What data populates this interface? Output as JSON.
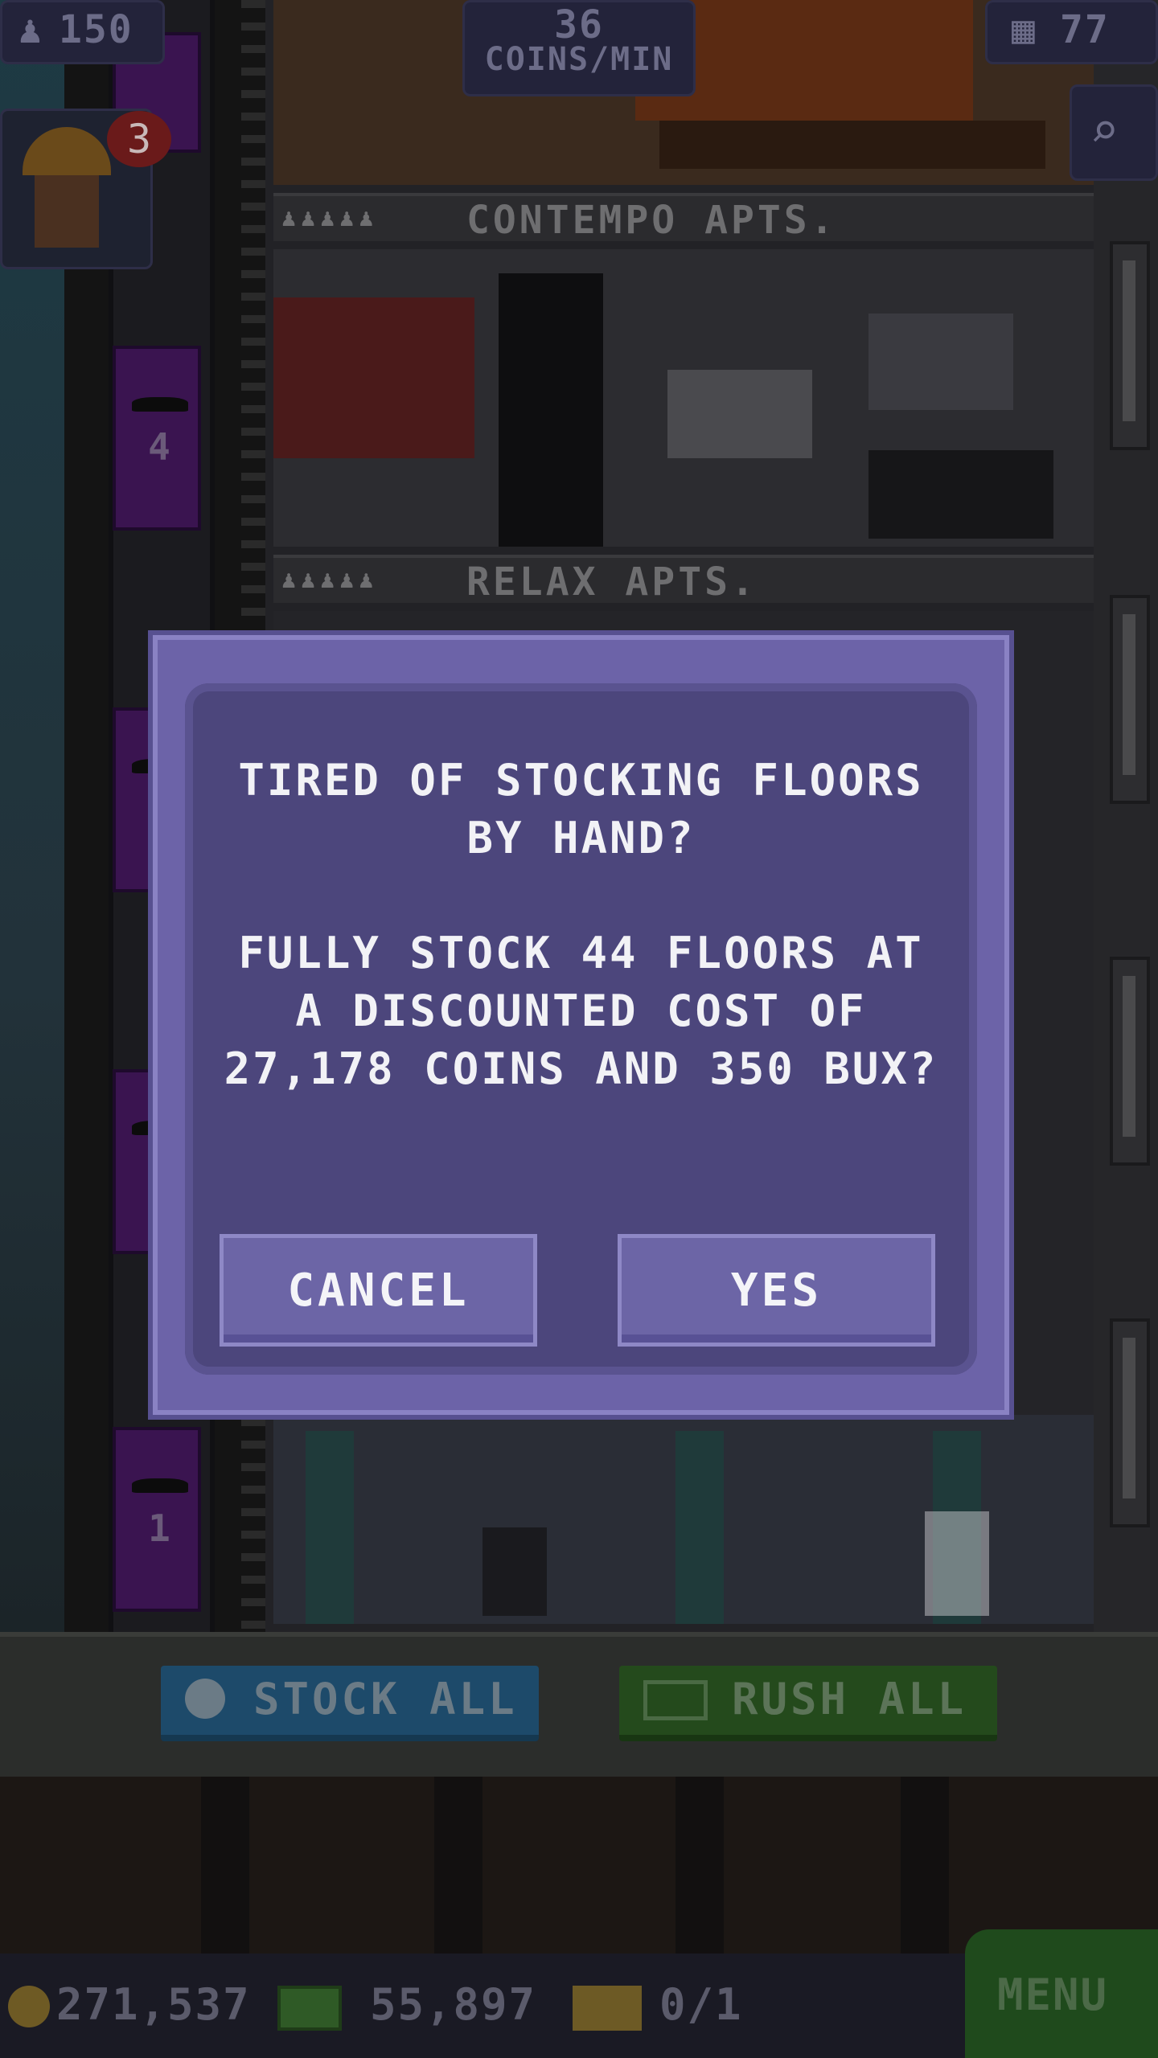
{
  "hud": {
    "population": "150",
    "coins_rate_value": "36",
    "coins_rate_unit": "COINS/MIN",
    "floors": "77",
    "notification_count": "3"
  },
  "tower": {
    "floors": [
      {
        "name": "CONTEMPO APTS."
      },
      {
        "name": "RELAX APTS."
      }
    ],
    "elevator_floor_numbers": [
      "4",
      "1"
    ]
  },
  "dialog": {
    "question": "TIRED OF STOCKING FLOORS BY HAND?",
    "offer": "FULLY STOCK 44 FLOORS AT A DISCOUNTED COST OF 27,178 COINS AND 350 BUX?",
    "cancel_label": "CANCEL",
    "yes_label": "YES"
  },
  "actions": {
    "stock_all_label": "STOCK ALL",
    "rush_all_label": "RUSH ALL"
  },
  "footer": {
    "coins": "271,537",
    "bux": "55,897",
    "tickets": "0/1",
    "menu_label": "MENU"
  },
  "colors": {
    "dialog_panel": "#4c467c",
    "dialog_frame": "#6c63a8",
    "button": "#6c65a6",
    "stock_all": "#1d4a6a",
    "rush_all": "#244a1c"
  }
}
